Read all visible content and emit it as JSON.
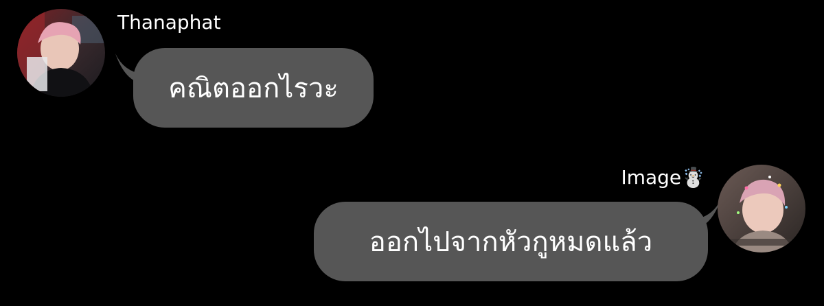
{
  "messages": [
    {
      "sender": "Thanaphat",
      "text": "คณิตออกไรวะ",
      "side": "left"
    },
    {
      "sender": "Image☃️",
      "text": "ออกไปจากหัวกูหมดแล้ว",
      "side": "right"
    }
  ],
  "colors": {
    "background": "#000000",
    "bubble": "#565656",
    "text": "#ffffff"
  }
}
